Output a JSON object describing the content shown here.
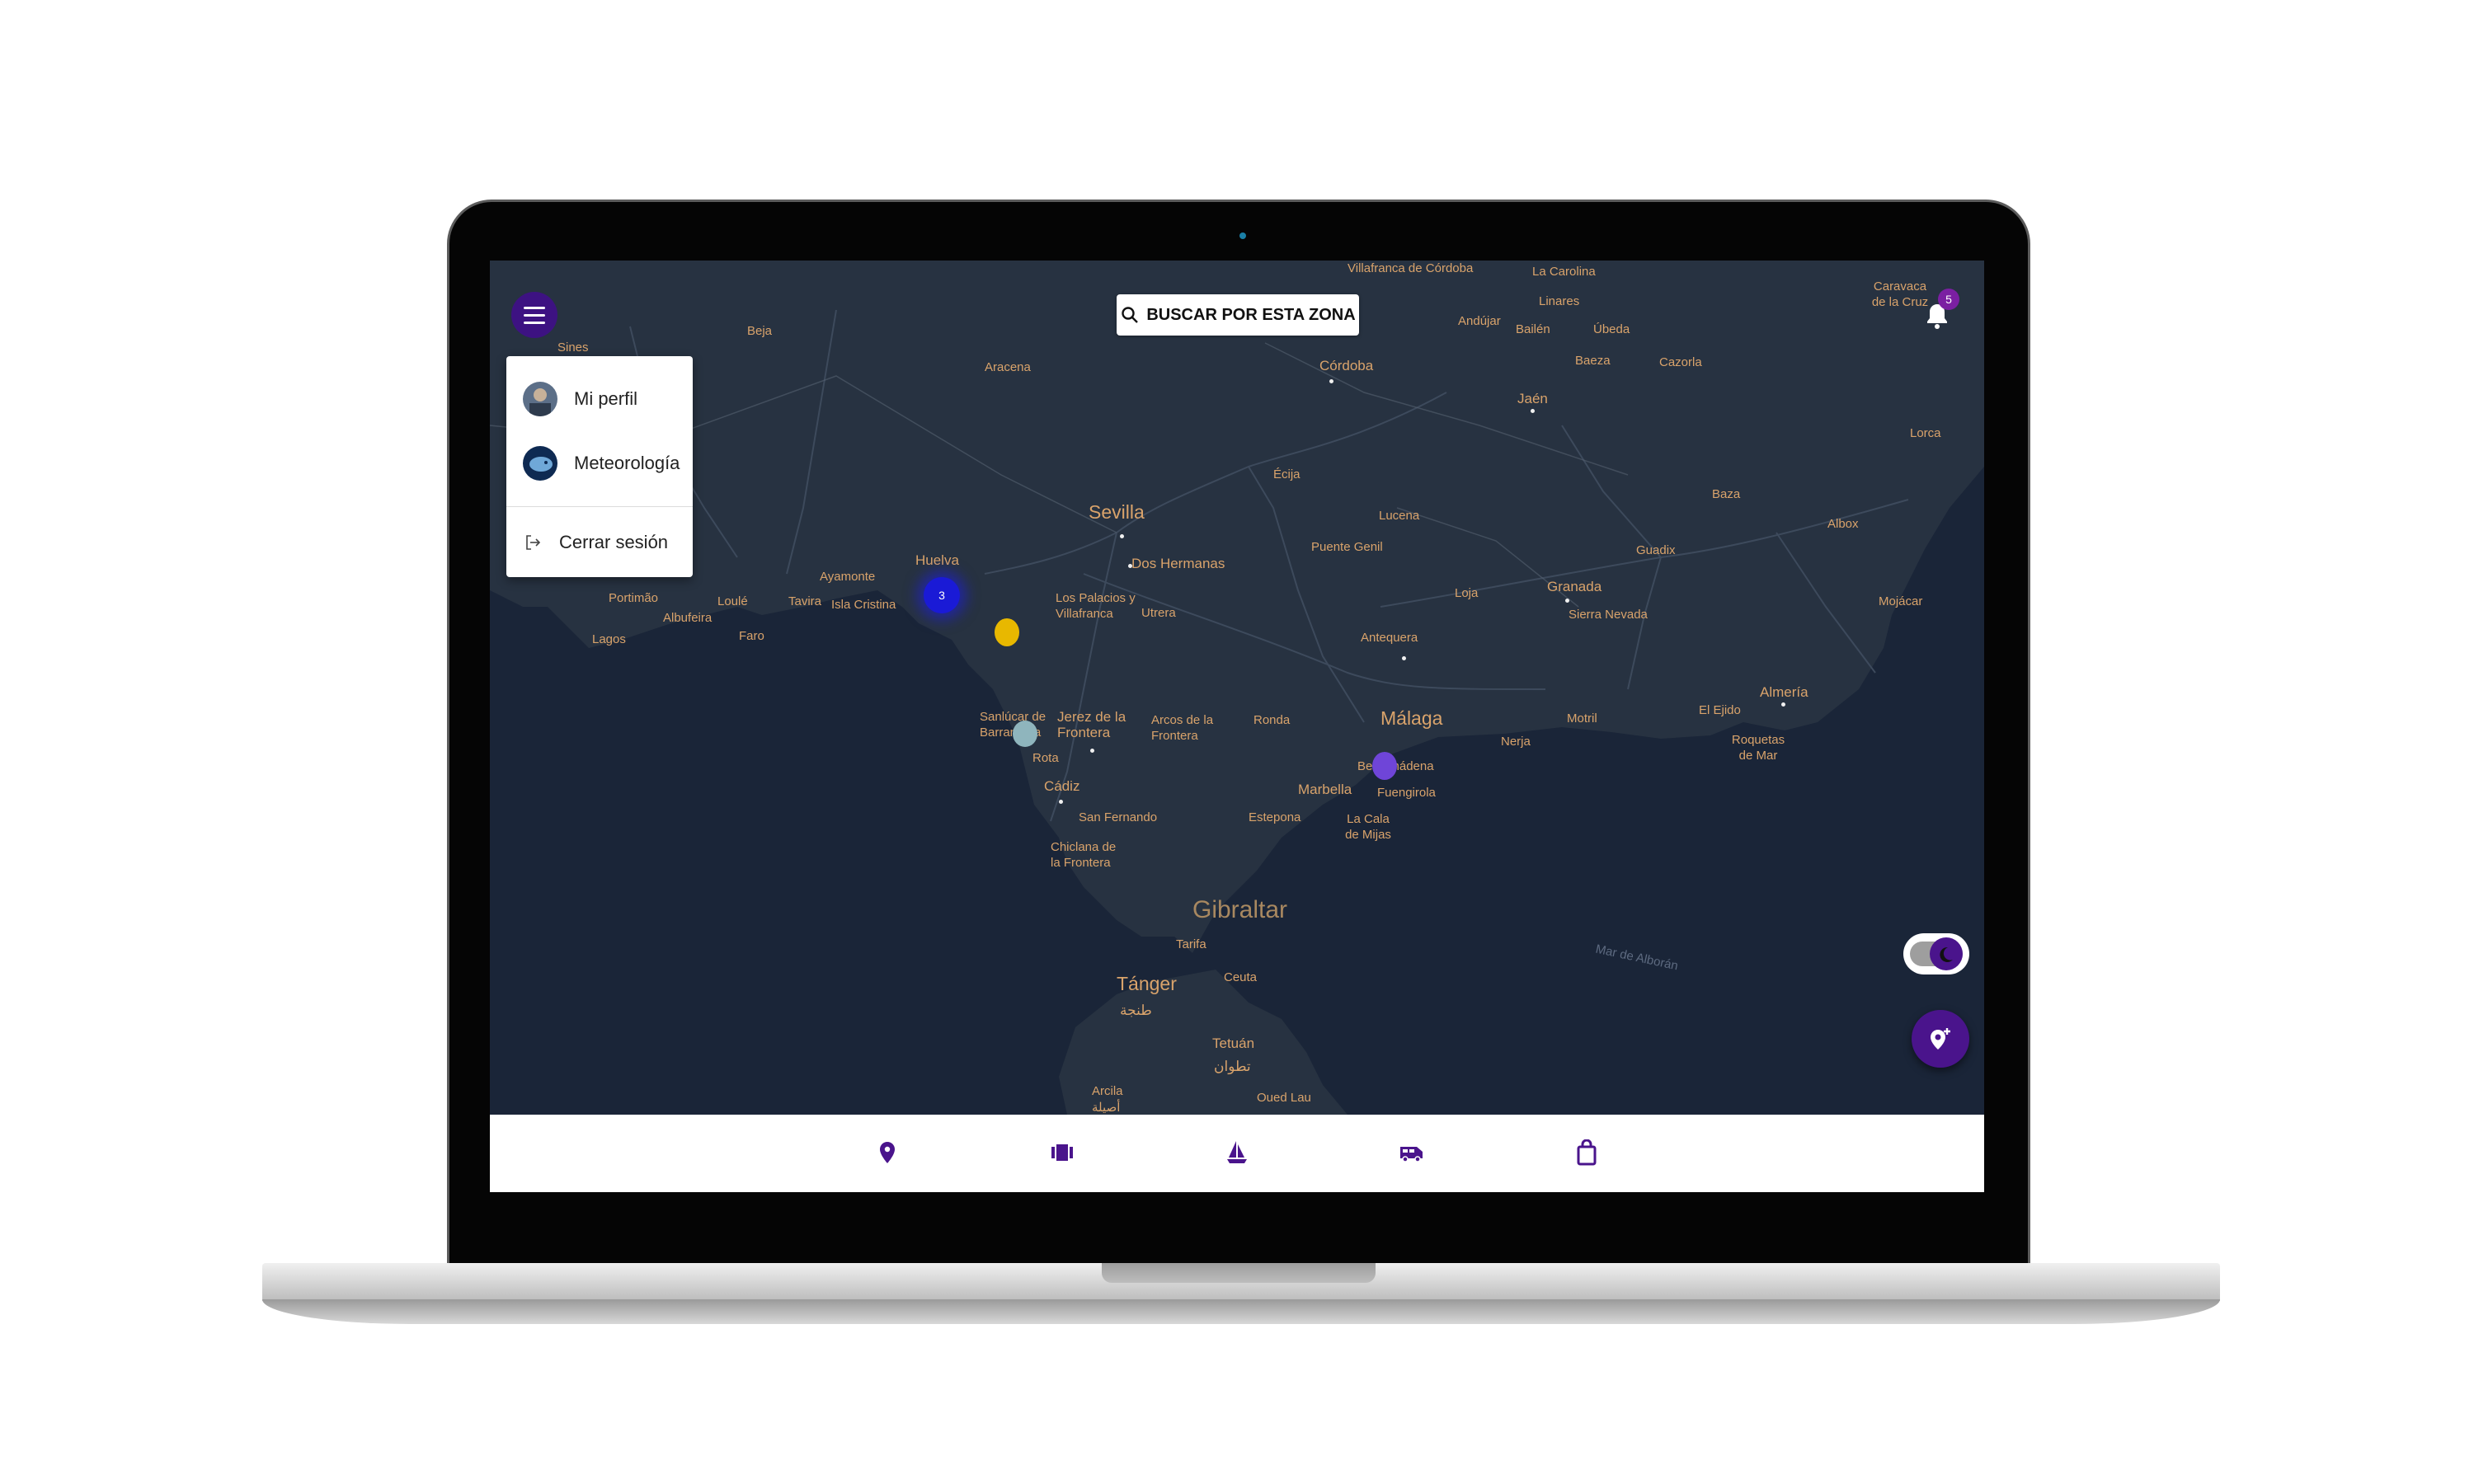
{
  "menu": {
    "items": [
      {
        "label": "Mi perfil",
        "icon": "profile-avatar"
      },
      {
        "label": "Meteorología",
        "icon": "weather-avatar"
      }
    ],
    "logout": {
      "label": "Cerrar sesión",
      "icon": "logout-icon"
    }
  },
  "search": {
    "label": "BUSCAR POR ESTA ZONA",
    "icon": "search-icon"
  },
  "notifications": {
    "count": "5",
    "icon": "bell-icon"
  },
  "map": {
    "cluster": {
      "count": "3"
    },
    "labels": {
      "villafranca_de_cordoba": "Villafranca de Córdoba",
      "la_carolina": "La Carolina",
      "caravaca": "Caravaca de la Cruz",
      "linares": "Linares",
      "andujar": "Andújar",
      "bailen": "Bailén",
      "ubeda": "Úbeda",
      "baeza": "Baeza",
      "cazorla": "Cazorla",
      "sines": "Sines",
      "beja": "Beja",
      "aracena": "Aracena",
      "cordoba": "Córdoba",
      "jaen": "Jaén",
      "lorca": "Lorca",
      "ecija": "Écija",
      "sevilla": "Sevilla",
      "lucena": "Lucena",
      "baza": "Baza",
      "albox": "Albox",
      "puente_genil": "Puente Genil",
      "guadix": "Guadix",
      "huelva": "Huelva",
      "dos_hermanas": "Dos Hermanas",
      "ayamonte": "Ayamonte",
      "portimao": "Portimão",
      "loule": "Loulé",
      "tavira": "Tavira",
      "isla_cristina": "Isla Cristina",
      "albufeira": "Albufeira",
      "faro": "Faro",
      "lagos": "Lagos",
      "los_palacios": "Los Palacios y Villafranca",
      "utrera": "Utrera",
      "loja": "Loja",
      "granada": "Granada",
      "sierra_nevada": "Sierra Nevada",
      "mojacar": "Mojácar",
      "antequera": "Antequera",
      "sanlucar": "Sanlúcar de Barrameda",
      "jerez": "Jerez de la Frontera",
      "arcos": "Arcos de la Frontera",
      "ronda": "Ronda",
      "malaga": "Málaga",
      "almeria": "Almería",
      "el_ejido": "El Ejido",
      "motril": "Motril",
      "nerja": "Nerja",
      "roquetas": "Roquetas de Mar",
      "rota": "Rota",
      "cadiz": "Cádiz",
      "benalmadena": "Benalmádena",
      "marbella": "Marbella",
      "fuengirola": "Fuengirola",
      "san_fernando": "San Fernando",
      "estepona": "Estepona",
      "la_cala": "La Cala de Mijas",
      "chiclana": "Chiclana de la Frontera",
      "gibraltar": "Gibraltar",
      "tarifa": "Tarifa",
      "mar_de_alboran": "Mar de Alborán",
      "ceuta": "Ceuta",
      "tanger": "Tánger",
      "tanger_ar": "طنجة",
      "tetuan": "Tetuán",
      "tetuan_ar": "تطوان",
      "oued_lau": "Oued Lau",
      "arcila": "Arcila",
      "arcila_ar": "أصيلة"
    }
  },
  "bottom_nav": [
    {
      "icon": "location-pin-icon"
    },
    {
      "icon": "carousel-icon"
    },
    {
      "icon": "sailboat-icon"
    },
    {
      "icon": "van-icon"
    },
    {
      "icon": "shopping-bag-icon"
    }
  ],
  "colors": {
    "accent": "#4a148c",
    "map_sea": "#1a2538",
    "map_land": "#273241",
    "map_label": "#d9a36b",
    "cluster": "#1a1ad6",
    "badge": "#7b1fa2"
  }
}
